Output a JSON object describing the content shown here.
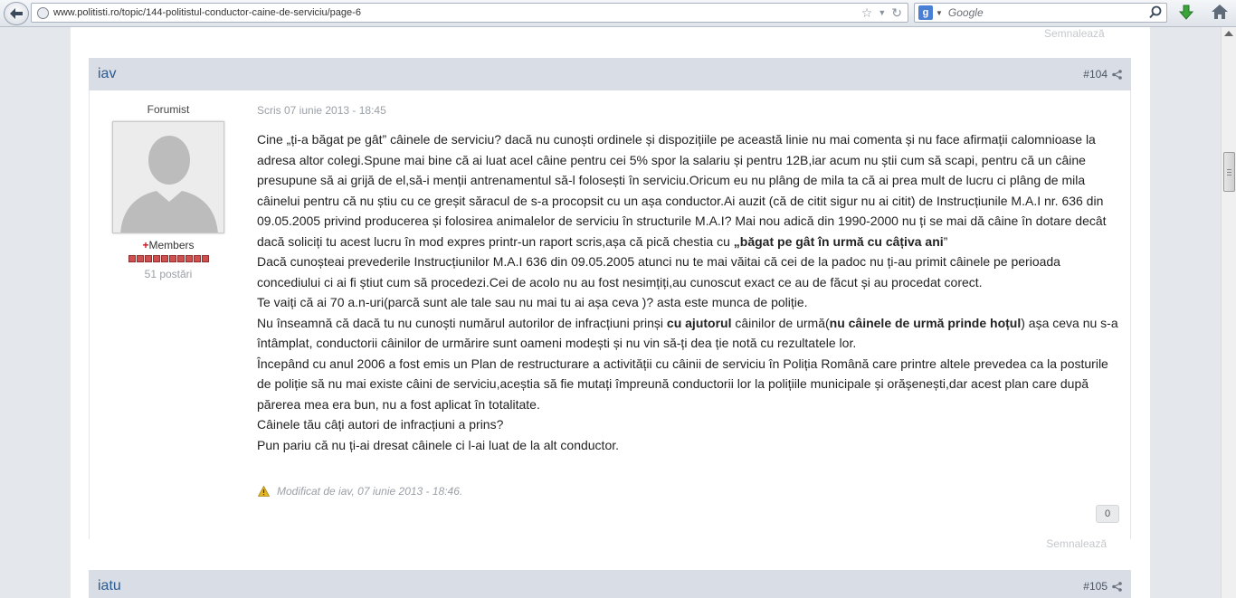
{
  "browser": {
    "url": "www.politisti.ro/topic/144-politistul-conductor-caine-de-serviciu/page-6",
    "search_engine_letter": "g",
    "search_placeholder": "Google"
  },
  "page": {
    "signal_top": "Semnalează",
    "post": {
      "author": "iav",
      "number": "#104",
      "user_title": "Forumist",
      "group": "Members",
      "post_count": "51 postări",
      "date": "Scris 07 iunie 2013 - 18:45",
      "paragraphs": [
        [
          {
            "t": "Cine „ți-a băgat pe gât” câinele de serviciu? dacă nu cunoști ordinele și dispozițiile pe această linie nu mai comenta și nu face afirmații calomnioase la adresa altor colegi.Spune mai bine că ai luat acel câine pentru cei 5% spor la salariu și pentru 12B,iar acum nu știi cum să scapi, pentru că un câine presupune să ai grijă de el,să-i menții antrenamentul să-l folosești în serviciu.Oricum eu nu plâng de mila ta că ai prea mult de lucru ci plâng de mila câinelui pentru că nu știu cu ce greșit săracul de s-a procopsit cu un așa conductor.Ai auzit (că de citit sigur nu ai citit) de Instrucțiunile M.A.I nr. 636 din 09.05.2005 privind producerea și folosirea animalelor de serviciu în structurile M.A.I? Mai nou adică din 1990-2000 nu ți se mai dă câine în dotare decât dacă soliciți tu acest lucru în mod expres printr-un raport scris,așa că pică chestia cu ",
            "b": false
          },
          {
            "t": "„băgat pe gât în urmă cu câțiva ani",
            "b": true
          },
          {
            "t": "”",
            "b": false
          }
        ],
        [
          {
            "t": "Dacă cunoșteai prevederile Instrucțiunilor M.A.I 636 din 09.05.2005 atunci nu te mai văitai că cei de la padoc nu ți-au primit câinele pe perioada concediului ci ai fi știut cum să procedezi.Cei de acolo nu au fost nesimțiți,au cunoscut exact ce au de făcut și au procedat corect.",
            "b": false
          }
        ],
        [
          {
            "t": "Te vaiți că ai 70 a.n-uri(parcă sunt ale tale sau nu mai tu ai așa ceva )? asta este munca de poliție.",
            "b": false
          }
        ],
        [
          {
            "t": "Nu înseamnă că dacă tu nu cunoști numărul autorilor de infracțiuni prinși ",
            "b": false
          },
          {
            "t": "cu ajutorul",
            "b": true
          },
          {
            "t": " câinilor de urmă(",
            "b": false
          },
          {
            "t": "nu câinele de urmă prinde hoțul",
            "b": true
          },
          {
            "t": ") așa ceva nu s-a întâmplat, conductorii câinilor de urmărire sunt oameni modești și nu vin să-ți dea ție notă cu rezultatele lor.",
            "b": false
          }
        ],
        [
          {
            "t": "Începând cu anul 2006 a fost emis un Plan de restructurare a activității cu câinii de serviciu în Poliția Română care printre altele prevedea ca la posturile de poliție să nu mai existe câini de serviciu,aceștia să fie mutați împreună conductorii lor la polițiile municipale și orășenești,dar acest plan care după părerea mea era bun, nu a fost aplicat în totalitate.",
            "b": false
          }
        ],
        [
          {
            "t": "Câinele tău câți autori de infracțiuni a prins?",
            "b": false
          }
        ],
        [
          {
            "t": "Pun pariu că nu ți-ai dresat câinele ci l-ai luat de la alt conductor.",
            "b": false
          }
        ]
      ],
      "edit_note": "Modificat de iav, 07 iunie 2013 - 18:46.",
      "reputation": "0",
      "signal": "Semnalează"
    },
    "next_post": {
      "author": "iatu",
      "number": "#105"
    }
  },
  "colors": {
    "header_bg": "#d8dde6",
    "author_link": "#2b5a8e",
    "pip_red": "#cf4f4f"
  },
  "icons": [
    "back-arrow-icon",
    "globe-icon",
    "star-icon",
    "dropdown-icon",
    "reload-icon",
    "search-icon",
    "download-arrow-icon",
    "home-icon",
    "share-icon",
    "warning-icon",
    "avatar-silhouette-icon"
  ]
}
